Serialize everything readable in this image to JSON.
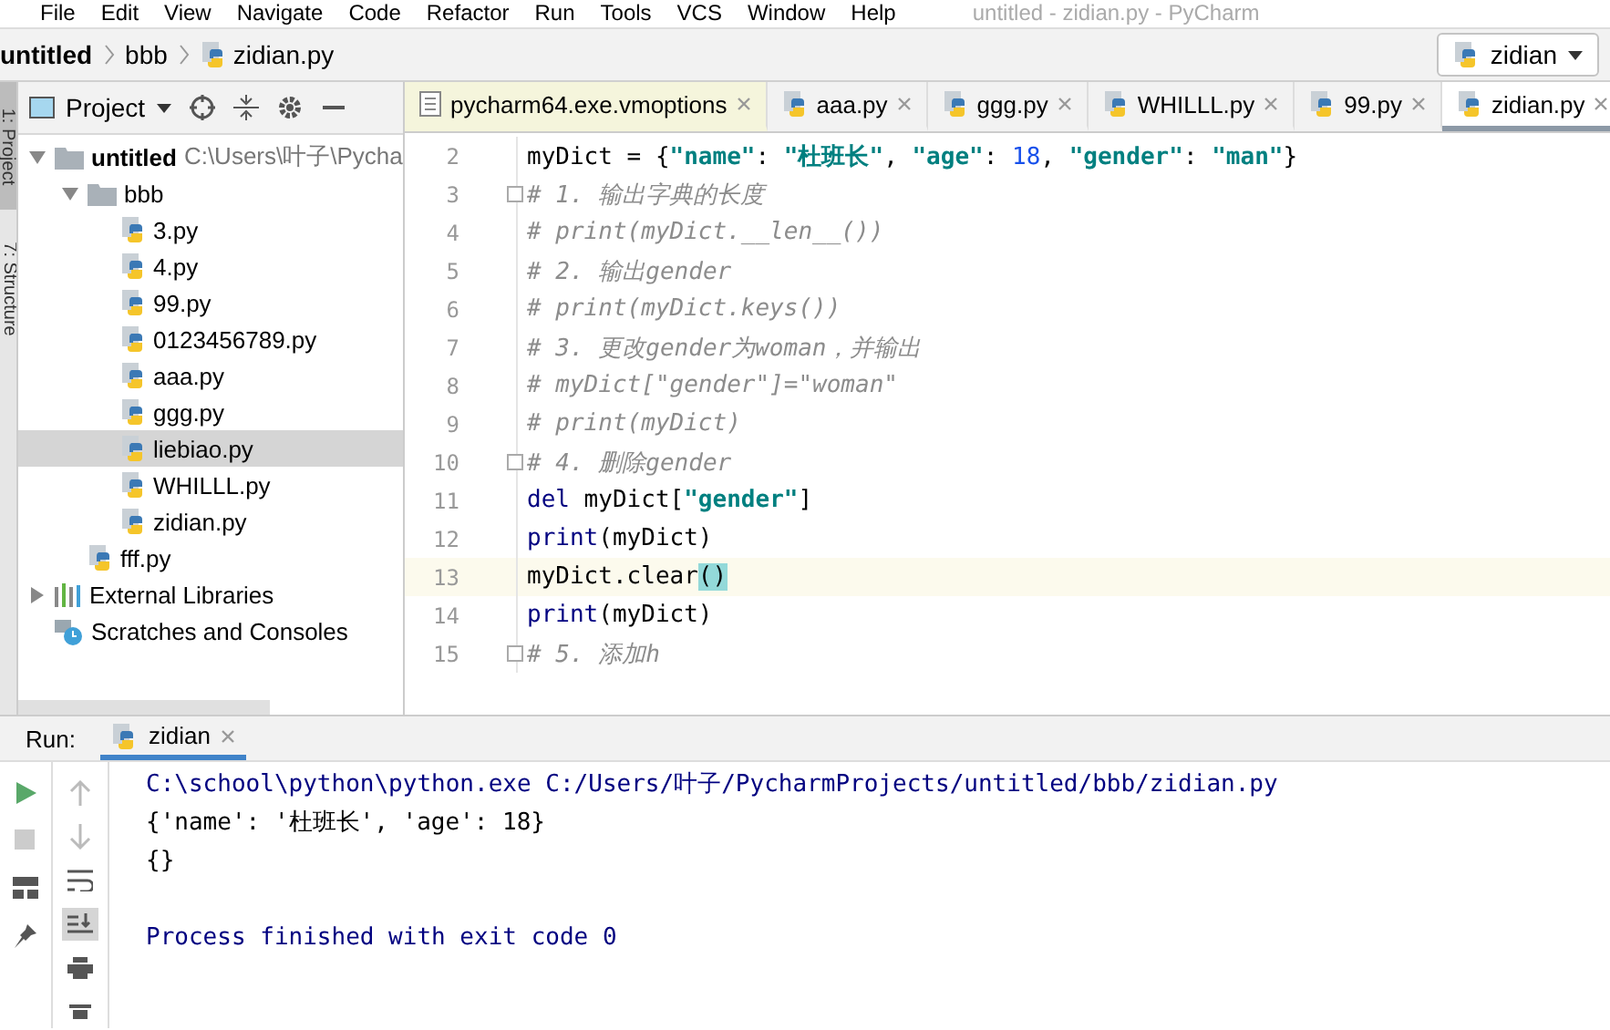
{
  "menu_bar": {
    "items": [
      "File",
      "Edit",
      "View",
      "Navigate",
      "Code",
      "Refactor",
      "Run",
      "Tools",
      "VCS",
      "Window",
      "Help"
    ],
    "title": "untitled - zidian.py - PyCharm"
  },
  "nav_bar": {
    "breadcrumbs": [
      {
        "label": "untitled",
        "kind": "project"
      },
      {
        "label": "bbb",
        "kind": "folder"
      },
      {
        "label": "zidian.py",
        "kind": "file"
      }
    ],
    "run_config": "zidian"
  },
  "side_strip": {
    "tabs": [
      {
        "label": "1: Project",
        "selected": true
      },
      {
        "label": "7: Structure",
        "selected": false
      }
    ]
  },
  "project_panel": {
    "title": "Project",
    "tree": [
      {
        "label": "untitled",
        "path": "C:\\Users\\叶子\\Pycha",
        "kind": "folder",
        "expanded": true,
        "selected": false,
        "children": [
          {
            "label": "bbb",
            "kind": "folder",
            "expanded": true,
            "selected": false,
            "children": [
              {
                "label": "3.py",
                "kind": "python",
                "selected": false
              },
              {
                "label": "4.py",
                "kind": "python",
                "selected": false
              },
              {
                "label": "99.py",
                "kind": "python",
                "selected": false
              },
              {
                "label": "0123456789.py",
                "kind": "python",
                "selected": false
              },
              {
                "label": "aaa.py",
                "kind": "python",
                "selected": false
              },
              {
                "label": "ggg.py",
                "kind": "python",
                "selected": false
              },
              {
                "label": "liebiao.py",
                "kind": "python",
                "selected": true
              },
              {
                "label": "WHILLL.py",
                "kind": "python",
                "selected": false
              },
              {
                "label": "zidian.py",
                "kind": "python",
                "selected": false
              }
            ]
          },
          {
            "label": "fff.py",
            "kind": "python",
            "selected": false
          }
        ]
      },
      {
        "label": "External Libraries",
        "kind": "libraries",
        "expanded": false,
        "selected": false
      },
      {
        "label": "Scratches and Consoles",
        "kind": "scratches",
        "selected": false
      }
    ]
  },
  "editor_tabs": [
    {
      "label": "pycharm64.exe.vmoptions",
      "kind": "text",
      "selected": false
    },
    {
      "label": "aaa.py",
      "kind": "python",
      "selected": false
    },
    {
      "label": "ggg.py",
      "kind": "python",
      "selected": false
    },
    {
      "label": "WHILLL.py",
      "kind": "python",
      "selected": false
    },
    {
      "label": "99.py",
      "kind": "python",
      "selected": false
    },
    {
      "label": "zidian.py",
      "kind": "python",
      "selected": true
    }
  ],
  "editor": {
    "lines": [
      {
        "number": "2",
        "current": false,
        "fold": false,
        "tokens": [
          {
            "kind": "plain",
            "text": "myDict = {"
          },
          {
            "kind": "string",
            "text": "\"name\""
          },
          {
            "kind": "plain",
            "text": ": "
          },
          {
            "kind": "string",
            "text": "\"杜班长\""
          },
          {
            "kind": "plain",
            "text": ", "
          },
          {
            "kind": "string",
            "text": "\"age\""
          },
          {
            "kind": "plain",
            "text": ": "
          },
          {
            "kind": "number",
            "text": "18"
          },
          {
            "kind": "plain",
            "text": ", "
          },
          {
            "kind": "string",
            "text": "\"gender\""
          },
          {
            "kind": "plain",
            "text": ": "
          },
          {
            "kind": "string",
            "text": "\"man\""
          },
          {
            "kind": "plain",
            "text": "}"
          }
        ]
      },
      {
        "number": "3",
        "current": false,
        "fold": true,
        "tokens": [
          {
            "kind": "comment",
            "text": "# 1. 输出字典的长度"
          }
        ]
      },
      {
        "number": "4",
        "current": false,
        "fold": false,
        "tokens": [
          {
            "kind": "comment",
            "text": "# print(myDict.__len__())"
          }
        ]
      },
      {
        "number": "5",
        "current": false,
        "fold": false,
        "tokens": [
          {
            "kind": "comment",
            "text": "# 2. 输出gender"
          }
        ]
      },
      {
        "number": "6",
        "current": false,
        "fold": false,
        "tokens": [
          {
            "kind": "comment",
            "text": "# print(myDict.keys())"
          }
        ]
      },
      {
        "number": "7",
        "current": false,
        "fold": false,
        "tokens": [
          {
            "kind": "comment",
            "text": "# 3. 更改gender为woman，并输出"
          }
        ]
      },
      {
        "number": "8",
        "current": false,
        "fold": false,
        "tokens": [
          {
            "kind": "comment",
            "text": "# myDict[\"gender\"]=\"woman\""
          }
        ]
      },
      {
        "number": "9",
        "current": false,
        "fold": false,
        "tokens": [
          {
            "kind": "comment",
            "text": "# print(myDict)"
          }
        ]
      },
      {
        "number": "10",
        "current": false,
        "fold": true,
        "tokens": [
          {
            "kind": "comment",
            "text": "# 4. 删除gender"
          }
        ]
      },
      {
        "number": "11",
        "current": false,
        "fold": false,
        "tokens": [
          {
            "kind": "keyword",
            "text": "del"
          },
          {
            "kind": "plain",
            "text": " myDict["
          },
          {
            "kind": "string",
            "text": "\"gender\""
          },
          {
            "kind": "plain",
            "text": "]"
          }
        ]
      },
      {
        "number": "12",
        "current": false,
        "fold": false,
        "tokens": [
          {
            "kind": "builtin",
            "text": "print"
          },
          {
            "kind": "plain",
            "text": "(myDict)"
          }
        ]
      },
      {
        "number": "13",
        "current": true,
        "fold": false,
        "tokens": [
          {
            "kind": "plain",
            "text": "myDict.clear"
          },
          {
            "kind": "match",
            "text": "()"
          }
        ]
      },
      {
        "number": "14",
        "current": false,
        "fold": false,
        "tokens": [
          {
            "kind": "builtin",
            "text": "print"
          },
          {
            "kind": "plain",
            "text": "(myDict)"
          }
        ]
      },
      {
        "number": "15",
        "current": false,
        "fold": true,
        "tokens": [
          {
            "kind": "comment",
            "text": "# 5. 添加h"
          }
        ]
      }
    ]
  },
  "run_panel": {
    "label": "Run:",
    "tab": "zidian",
    "console": [
      {
        "kind": "command",
        "text": "C:\\school\\python\\python.exe C:/Users/叶子/PycharmProjects/untitled/bbb/zidian.py"
      },
      {
        "kind": "output",
        "text": "{'name': '杜班长', 'age': 18}"
      },
      {
        "kind": "output",
        "text": "{}"
      },
      {
        "kind": "process",
        "text": "Process finished with exit code 0"
      }
    ]
  }
}
